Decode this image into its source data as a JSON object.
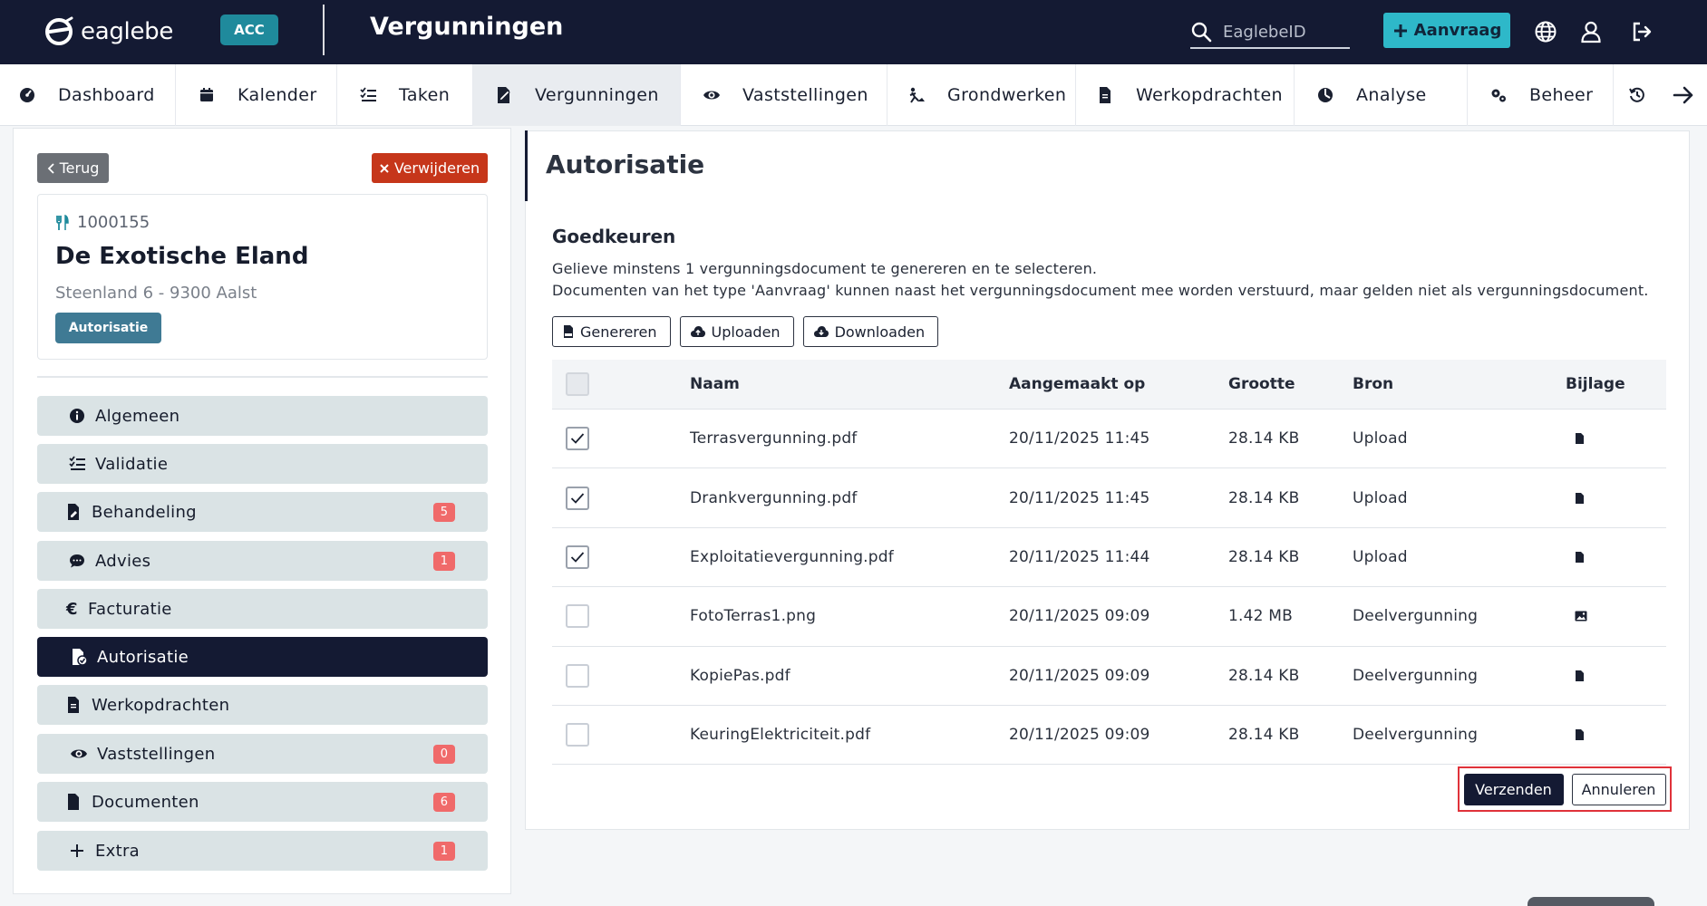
{
  "topbar": {
    "brand": "eaglebe",
    "env_badge": "ACC",
    "section_title": "Vergunningen",
    "search_placeholder": "EaglebeID",
    "new_request_label": "Aanvraag"
  },
  "nav": {
    "tabs": [
      {
        "label": "Dashboard",
        "icon": "dashboard-icon"
      },
      {
        "label": "Kalender",
        "icon": "calendar-icon"
      },
      {
        "label": "Taken",
        "icon": "tasks-icon"
      },
      {
        "label": "Vergunningen",
        "icon": "permit-icon",
        "active": true
      },
      {
        "label": "Vaststellingen",
        "icon": "eye-icon"
      },
      {
        "label": "Grondwerken",
        "icon": "digging-icon"
      },
      {
        "label": "Werkopdrachten",
        "icon": "document-icon"
      },
      {
        "label": "Analyse",
        "icon": "analysis-icon"
      },
      {
        "label": "Beheer",
        "icon": "gears-icon"
      }
    ]
  },
  "dossier": {
    "back_label": "Terug",
    "delete_label": "Verwijderen",
    "id": "1000155",
    "name": "De Exotische Eland",
    "address": "Steenland 6 - 9300 Aalst",
    "status": "Autorisatie"
  },
  "sidebar": {
    "items": [
      {
        "label": "Algemeen",
        "icon": "info-icon"
      },
      {
        "label": "Validatie",
        "icon": "checklist-icon"
      },
      {
        "label": "Behandeling",
        "icon": "file-edit-icon",
        "count": "5"
      },
      {
        "label": "Advies",
        "icon": "comment-icon",
        "count": "1"
      },
      {
        "label": "Facturatie",
        "icon": "euro-icon"
      },
      {
        "label": "Autorisatie",
        "icon": "file-check-icon",
        "active": true
      },
      {
        "label": "Werkopdrachten",
        "icon": "document-icon"
      },
      {
        "label": "Vaststellingen",
        "icon": "eye-icon",
        "count": "0"
      },
      {
        "label": "Documenten",
        "icon": "file-icon",
        "count": "6"
      },
      {
        "label": "Extra",
        "icon": "plus-icon",
        "count": "1"
      }
    ]
  },
  "main": {
    "title": "Autorisatie",
    "section_title": "Goedkeuren",
    "description_line1": "Gelieve minstens 1 vergunningsdocument te genereren en te selecteren.",
    "description_line2": "Documenten van het type 'Aanvraag' kunnen naast het vergunningsdocument mee worden verstuurd, maar gelden niet als vergunningsdocument.",
    "actions": {
      "generate": "Genereren",
      "upload": "Uploaden",
      "download": "Downloaden"
    },
    "table": {
      "headers": {
        "naam": "Naam",
        "aangemaakt": "Aangemaakt op",
        "grootte": "Grootte",
        "bron": "Bron",
        "bijlage": "Bijlage"
      },
      "rows": [
        {
          "checked": true,
          "naam": "Terrasvergunning.pdf",
          "aangemaakt": "20/11/2025 11:45",
          "grootte": "28.14 KB",
          "bron": "Upload",
          "bijlage_icon": "file-icon"
        },
        {
          "checked": true,
          "naam": "Drankvergunning.pdf",
          "aangemaakt": "20/11/2025 11:45",
          "grootte": "28.14 KB",
          "bron": "Upload",
          "bijlage_icon": "file-icon"
        },
        {
          "checked": true,
          "naam": "Exploitatievergunning.pdf",
          "aangemaakt": "20/11/2025 11:44",
          "grootte": "28.14 KB",
          "bron": "Upload",
          "bijlage_icon": "file-icon"
        },
        {
          "checked": false,
          "naam": "FotoTerras1.png",
          "aangemaakt": "20/11/2025 09:09",
          "grootte": "1.42 MB",
          "bron": "Deelvergunning",
          "bijlage_icon": "image-icon"
        },
        {
          "checked": false,
          "naam": "KopiePas.pdf",
          "aangemaakt": "20/11/2025 09:09",
          "grootte": "28.14 KB",
          "bron": "Deelvergunning",
          "bijlage_icon": "file-icon"
        },
        {
          "checked": false,
          "naam": "KeuringElektriciteit.pdf",
          "aangemaakt": "20/11/2025 09:09",
          "grootte": "28.14 KB",
          "bron": "Deelvergunning",
          "bijlage_icon": "file-icon"
        }
      ]
    },
    "submit_label": "Verzenden",
    "cancel_label": "Annuleren"
  },
  "colors": {
    "topbar": "#141a33",
    "accent": "#2eb8c9",
    "danger": "#c6361a",
    "status_badge": "#3f7a94",
    "count_badge": "#f06a6a",
    "highlight": "#e0323a"
  }
}
